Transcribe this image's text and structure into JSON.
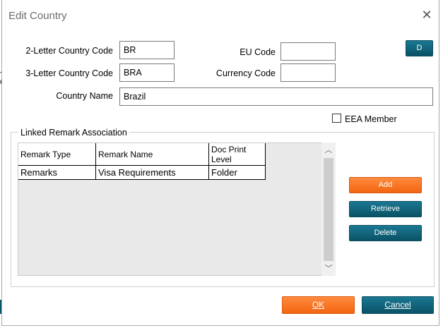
{
  "dialog": {
    "title": "Edit Country",
    "close_icon": "close-icon"
  },
  "fields": {
    "code2_label": "2-Letter Country Code",
    "code2_value": "BR",
    "code3_label": "3-Letter Country Code",
    "code3_value": "BRA",
    "eu_label": "EU Code",
    "eu_value": "",
    "currency_label": "Currency Code",
    "currency_value": "",
    "name_label": "Country Name",
    "name_value": "Brazil",
    "eea_label": "EEA Member",
    "eea_checked": false
  },
  "d_button": "D",
  "linked_remarks": {
    "title": "Linked Remark Association",
    "columns": [
      "Remark Type",
      "Remark Name",
      "Doc Print Level"
    ],
    "rows": [
      [
        "Remarks",
        "Visa Requirements",
        "Folder"
      ]
    ]
  },
  "actions": {
    "add": "Add",
    "retrieve": "Retrieve",
    "delete": "Delete"
  },
  "footer": {
    "ok": "OK",
    "cancel": "Cancel"
  },
  "colors": {
    "teal": "#0a5266",
    "orange": "#f26510"
  }
}
